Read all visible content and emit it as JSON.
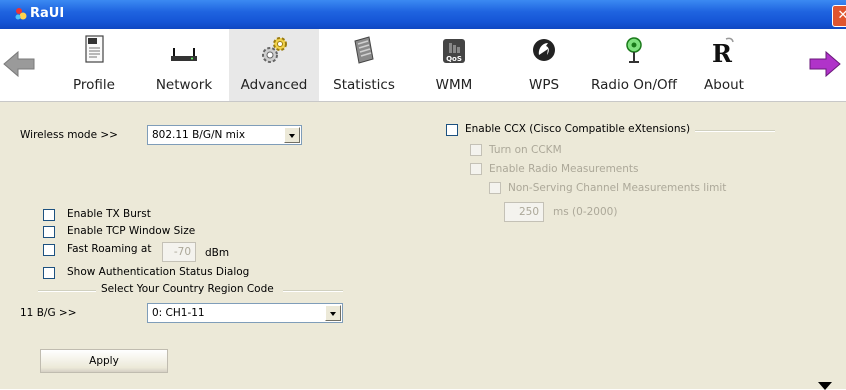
{
  "window": {
    "title": "RaUI",
    "close_symbol": "✕",
    "colors": {
      "titlebar": "#1f64e0",
      "close": "#e0552f",
      "panel": "#ece9d8"
    }
  },
  "toolbar": {
    "back_icon": "back-arrow-icon",
    "forward_icon": "forward-arrow-icon",
    "active": "Advanced",
    "items": [
      {
        "label": "Profile",
        "icon": "profile-document-icon"
      },
      {
        "label": "Network",
        "icon": "network-router-icon"
      },
      {
        "label": "Advanced",
        "icon": "gears-icon"
      },
      {
        "label": "Statistics",
        "icon": "statistics-icon"
      },
      {
        "label": "WMM",
        "icon": "wmm-qos-icon"
      },
      {
        "label": "WPS",
        "icon": "wps-icon"
      },
      {
        "label": "Radio On/Off",
        "icon": "radio-antenna-icon"
      },
      {
        "label": "About",
        "icon": "ralink-logo-icon"
      }
    ]
  },
  "advanced": {
    "wireless_mode_label": "Wireless mode >>",
    "wireless_mode_value": "802.11 B/G/N mix",
    "options": {
      "tx_burst": {
        "label": "Enable TX Burst",
        "checked": false
      },
      "tcp_window": {
        "label": "Enable TCP Window Size",
        "checked": false
      },
      "fast_roaming": {
        "label": "Fast Roaming at",
        "checked": false,
        "value": "-70",
        "unit": "dBm"
      },
      "auth_dialog": {
        "label": "Show Authentication Status Dialog",
        "checked": false
      }
    },
    "country_region": {
      "legend": "Select Your Country Region Code",
      "label": "11 B/G >>",
      "value": "0: CH1-11"
    },
    "apply_label": "Apply",
    "ccx": {
      "label": "Enable CCX (Cisco Compatible eXtensions)",
      "checked": false,
      "turn_on_cckm": "Turn on CCKM",
      "enable_radio_measurements": "Enable Radio Measurements",
      "non_serving_limit": "Non-Serving Channel Measurements limit",
      "limit_value": "250",
      "limit_unit": "ms (0-2000)"
    }
  }
}
